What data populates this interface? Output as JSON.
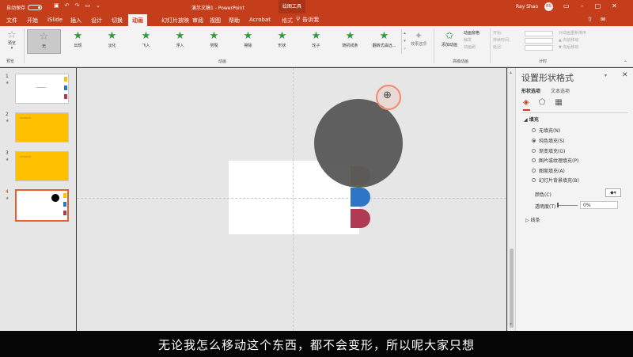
{
  "titlebar": {
    "autosave_label": "自动保存",
    "autosave_state": "关",
    "doc_title": "演示文稿1 - PowerPoint",
    "context_tab": "绘图工具",
    "user": "Ray Shao",
    "avatar_initials": "RS",
    "qat_icons": [
      "save-icon",
      "undo-icon",
      "redo-icon",
      "start-presentation-icon",
      "customize-icon"
    ]
  },
  "tabs": {
    "items": [
      "文件",
      "开始",
      "iSlide",
      "插入",
      "设计",
      "切换",
      "动画",
      "幻灯片放映",
      "审阅",
      "视图",
      "帮助",
      "Acrobat",
      "格式"
    ],
    "active": "动画",
    "search_placeholder": "告诉我"
  },
  "ribbon": {
    "preview_label": "预览",
    "preview_group": "预览",
    "animations": [
      "无",
      "出现",
      "淡化",
      "飞入",
      "浮入",
      "劈裂",
      "擦除",
      "形状",
      "轮子",
      "随机线条",
      "翻转式由远..."
    ],
    "animation_group": "动画",
    "effect_options": "效果选项",
    "add_animation": "添加动画",
    "advanced": [
      "动画窗格",
      "触发",
      "动画刷"
    ],
    "advanced_group": "高级动画",
    "timing_left": [
      "开始:",
      "持续时间:",
      "延迟:"
    ],
    "timing_right": [
      "对动画重新排序",
      "▲ 向前移动",
      "▼ 向后移动"
    ],
    "timing_group": "计时"
  },
  "thumbnails": [
    {
      "num": "1",
      "active": false,
      "style": "white"
    },
    {
      "num": "2",
      "active": false,
      "style": "yellow"
    },
    {
      "num": "3",
      "active": false,
      "style": "yellow"
    },
    {
      "num": "4",
      "active": true,
      "style": "white"
    }
  ],
  "colors": {
    "accent": "#c43e1c",
    "circle": "#595959",
    "gold": "#9a7200",
    "blue": "#2f75c5",
    "red": "#b03a51",
    "yellow": "#ffc000"
  },
  "format_pane": {
    "title": "设置形状格式",
    "subtab_shape": "形状选项",
    "subtab_text": "文本选项",
    "fill_heading": "填充",
    "fill_options": [
      "无填充(N)",
      "纯色填充(S)",
      "渐变填充(G)",
      "图片或纹理填充(P)",
      "图案填充(A)",
      "幻灯片背景填充(B)"
    ],
    "selected_fill_index": 1,
    "color_label": "颜色(C)",
    "transparency_label": "透明度(T)",
    "transparency_value": "0%",
    "line_heading": "线条"
  },
  "subtitle": "无论我怎么移动这个东西，都不会变形，所以呢大家只想"
}
